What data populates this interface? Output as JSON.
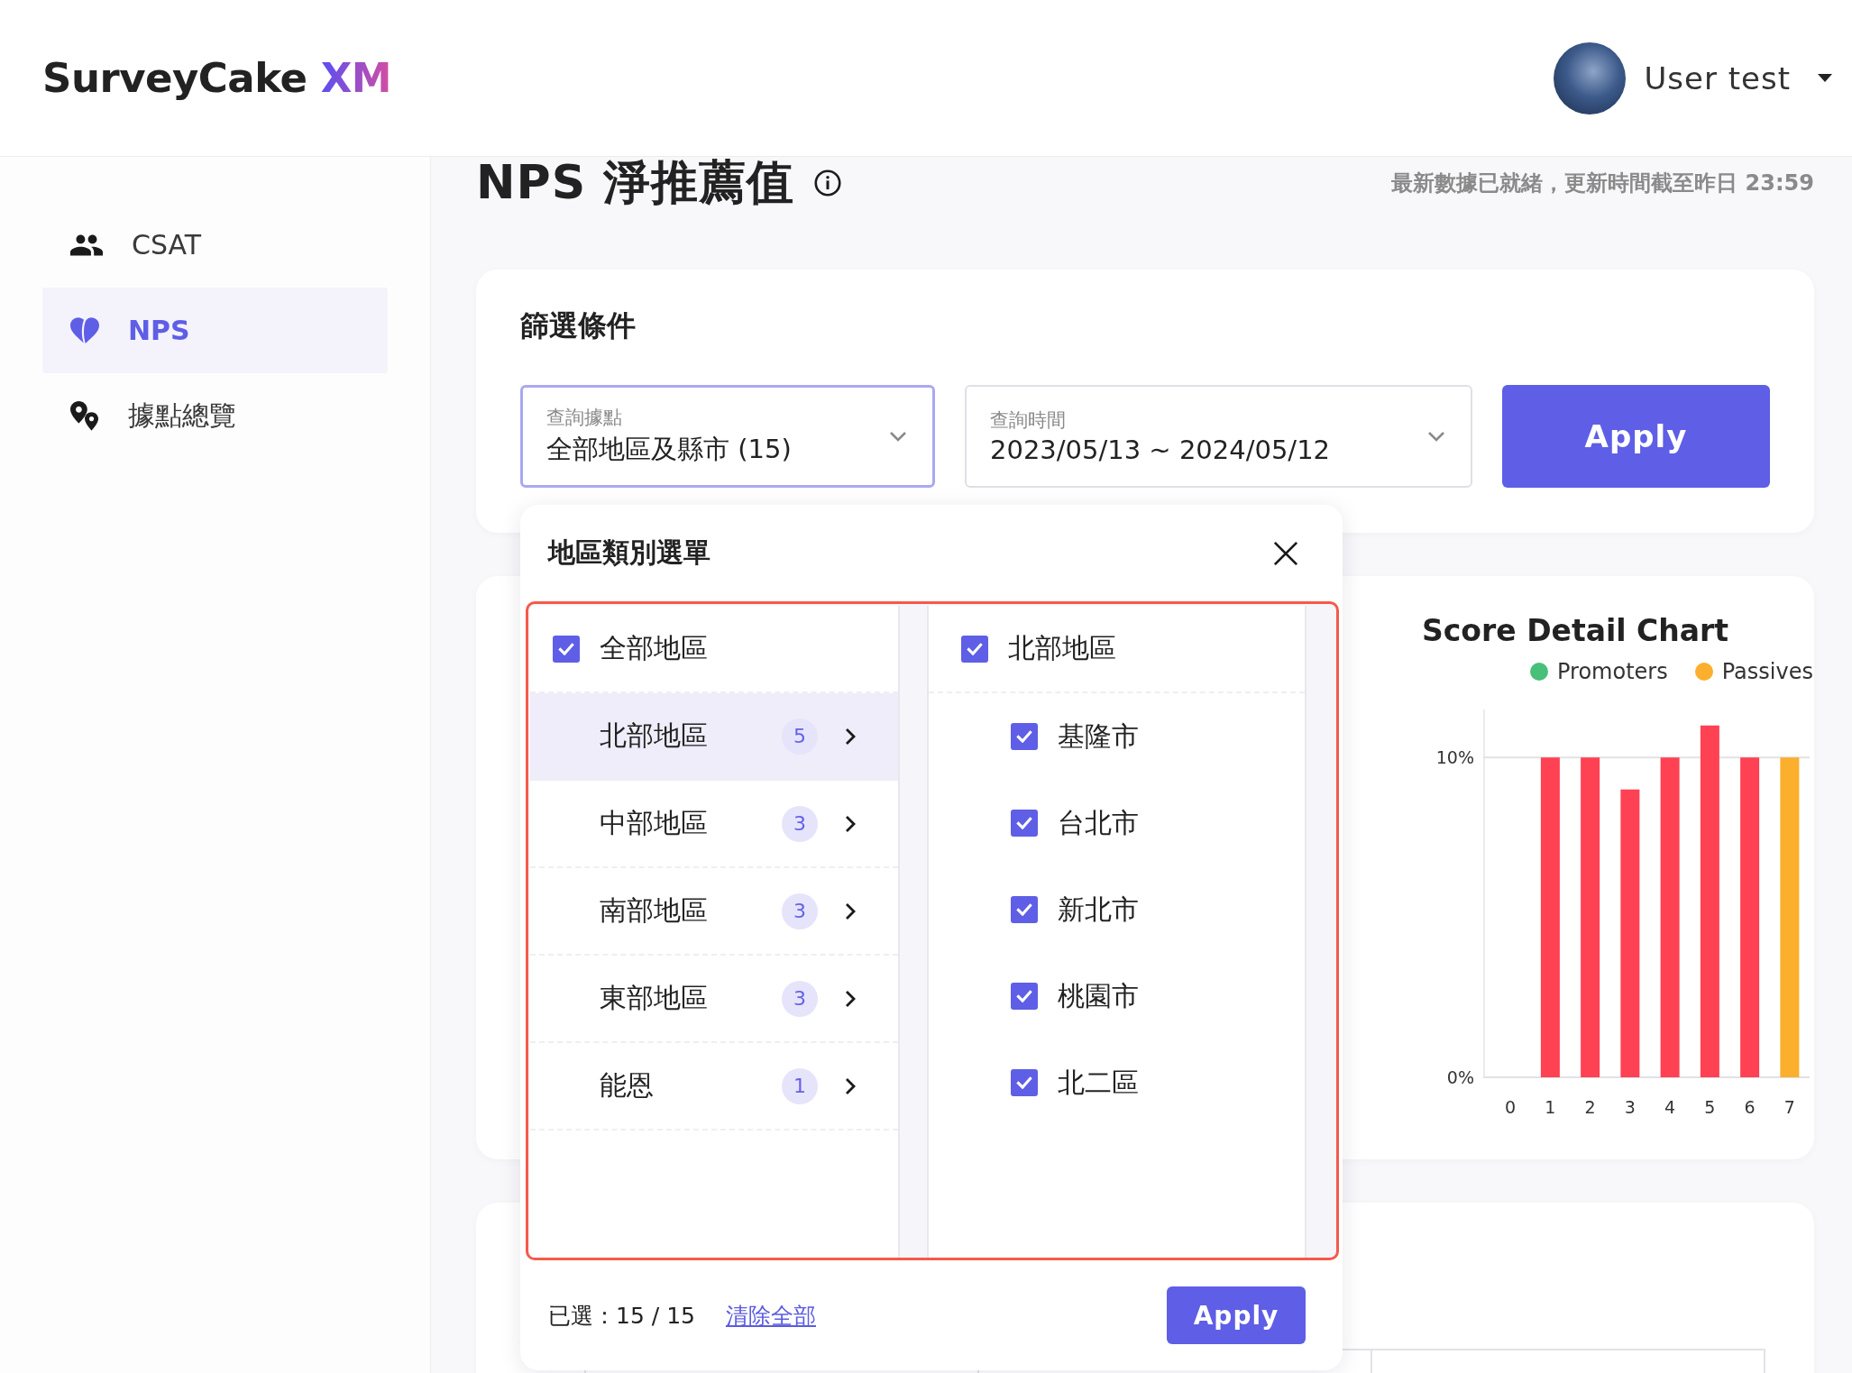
{
  "header": {
    "logo": {
      "name": "SurveyCake",
      "suffix": "XM"
    },
    "user": {
      "name": "User test"
    }
  },
  "sidebar": {
    "items": [
      {
        "label": "CSAT",
        "selected": false
      },
      {
        "label": "NPS",
        "selected": true
      },
      {
        "label": "據點總覽",
        "selected": false
      }
    ]
  },
  "page": {
    "title": "NPS 淨推薦值",
    "status": "最新數據已就緒，更新時間截至昨日 23:59"
  },
  "filter": {
    "title": "篩選條件",
    "fields": [
      {
        "label": "查詢據點",
        "value": "全部地區及縣市 (15)",
        "expanded": true
      },
      {
        "label": "查詢時間",
        "value": "2023/05/13 ~ 2024/05/12",
        "expanded": false
      }
    ],
    "apply": "Apply"
  },
  "chart_card": {
    "title": "Score Detail Chart",
    "legend": [
      {
        "label": "Promoters",
        "color": "#48c07a"
      },
      {
        "label": "Passives",
        "color": "#fbaf2d"
      }
    ],
    "chart_data": {
      "type": "bar",
      "categories": [
        "0",
        "1",
        "2",
        "3",
        "4",
        "5",
        "6",
        "7"
      ],
      "series": [
        {
          "color": "#ff4154",
          "values": [
            0,
            10,
            10,
            9,
            10,
            11,
            10,
            null
          ]
        },
        {
          "color": "#fbaf2d",
          "values": [
            null,
            null,
            null,
            null,
            null,
            null,
            null,
            10
          ]
        }
      ],
      "ylim": [
        0,
        11.5
      ],
      "yticks": [
        {
          "value": 0,
          "label": "0%"
        },
        {
          "value": 10,
          "label": "10%"
        }
      ],
      "stacked": true
    }
  },
  "region_menu": {
    "title": "地區類別選單",
    "all": {
      "label": "全部地區",
      "checked": true
    },
    "groups": [
      {
        "label": "北部地區",
        "count": "5",
        "selected": true
      },
      {
        "label": "中部地區",
        "count": "3",
        "selected": false
      },
      {
        "label": "南部地區",
        "count": "3",
        "selected": false
      },
      {
        "label": "東部地區",
        "count": "3",
        "selected": false
      },
      {
        "label": "能恩",
        "count": "1",
        "selected": false
      }
    ],
    "detail": {
      "label": "北部地區",
      "checked": true,
      "children": [
        {
          "label": "基隆市",
          "checked": true
        },
        {
          "label": "台北市",
          "checked": true
        },
        {
          "label": "新北市",
          "checked": true
        },
        {
          "label": "桃園市",
          "checked": true
        },
        {
          "label": "北二區",
          "checked": true
        }
      ]
    },
    "summary": "已選：15 / 15",
    "clear": "清除全部",
    "apply": "Apply"
  }
}
